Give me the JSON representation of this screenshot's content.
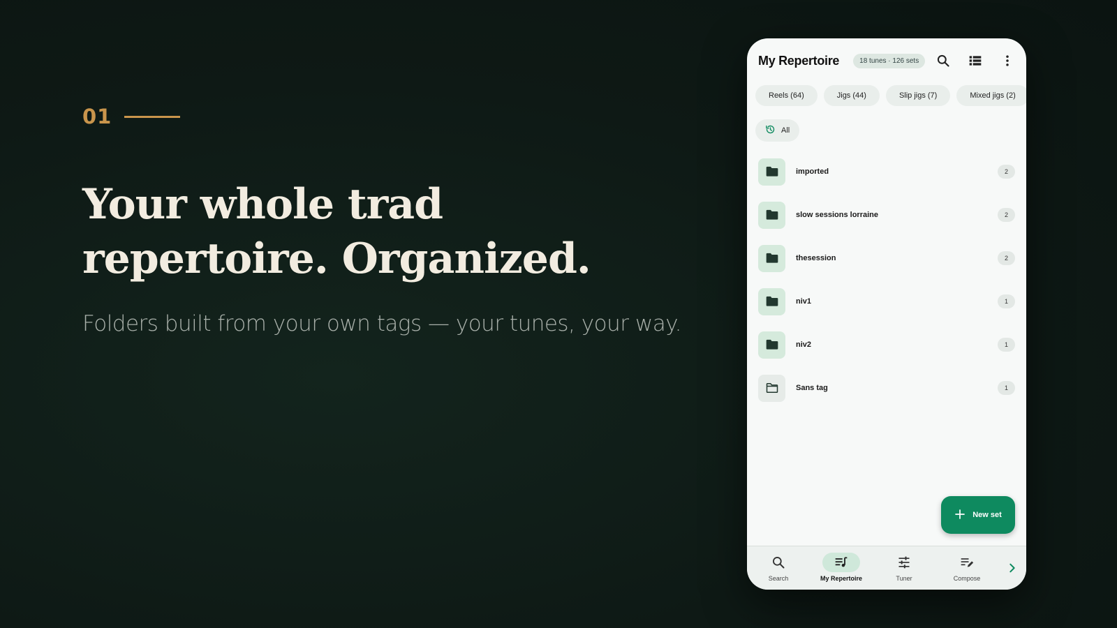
{
  "hero": {
    "step_number": "01",
    "headline_line1": "Your whole trad",
    "headline_line2": "repertoire. Organized.",
    "subline": "Folders built from your own tags — your tunes, your way."
  },
  "app": {
    "title": "My Repertoire",
    "counts": "18 tunes · 126 sets",
    "actions": [
      "search-icon",
      "list-view-icon",
      "more-vert-icon"
    ],
    "filter_chips": [
      "Reels (64)",
      "Jigs (44)",
      "Slip jigs (7)",
      "Mixed jigs (2)"
    ],
    "all_chip": {
      "label": "All",
      "icon": "history-icon"
    },
    "folders": [
      {
        "name": "imported",
        "count": "2",
        "icon": "folder-filled-icon"
      },
      {
        "name": "slow sessions lorraine",
        "count": "2",
        "icon": "folder-filled-icon"
      },
      {
        "name": "thesession",
        "count": "2",
        "icon": "folder-filled-icon"
      },
      {
        "name": "niv1",
        "count": "1",
        "icon": "folder-filled-icon"
      },
      {
        "name": "niv2",
        "count": "1",
        "icon": "folder-filled-icon"
      },
      {
        "name": "Sans tag",
        "count": "1",
        "icon": "folder-outline-icon"
      }
    ],
    "fab_label": "New set",
    "nav": [
      {
        "label": "Search",
        "icon": "search-icon",
        "active": false
      },
      {
        "label": "My Repertoire",
        "icon": "playlist-music-icon",
        "active": true
      },
      {
        "label": "Tuner",
        "icon": "tune-icon",
        "active": false
      },
      {
        "label": "Compose",
        "icon": "edit-note-icon",
        "active": false
      }
    ]
  },
  "colors": {
    "background": "#0e1915",
    "accent_gold": "#c9954c",
    "headline": "#f2ece0",
    "brand_green": "#0e8a5f",
    "folder_tint": "#d5eadc"
  }
}
